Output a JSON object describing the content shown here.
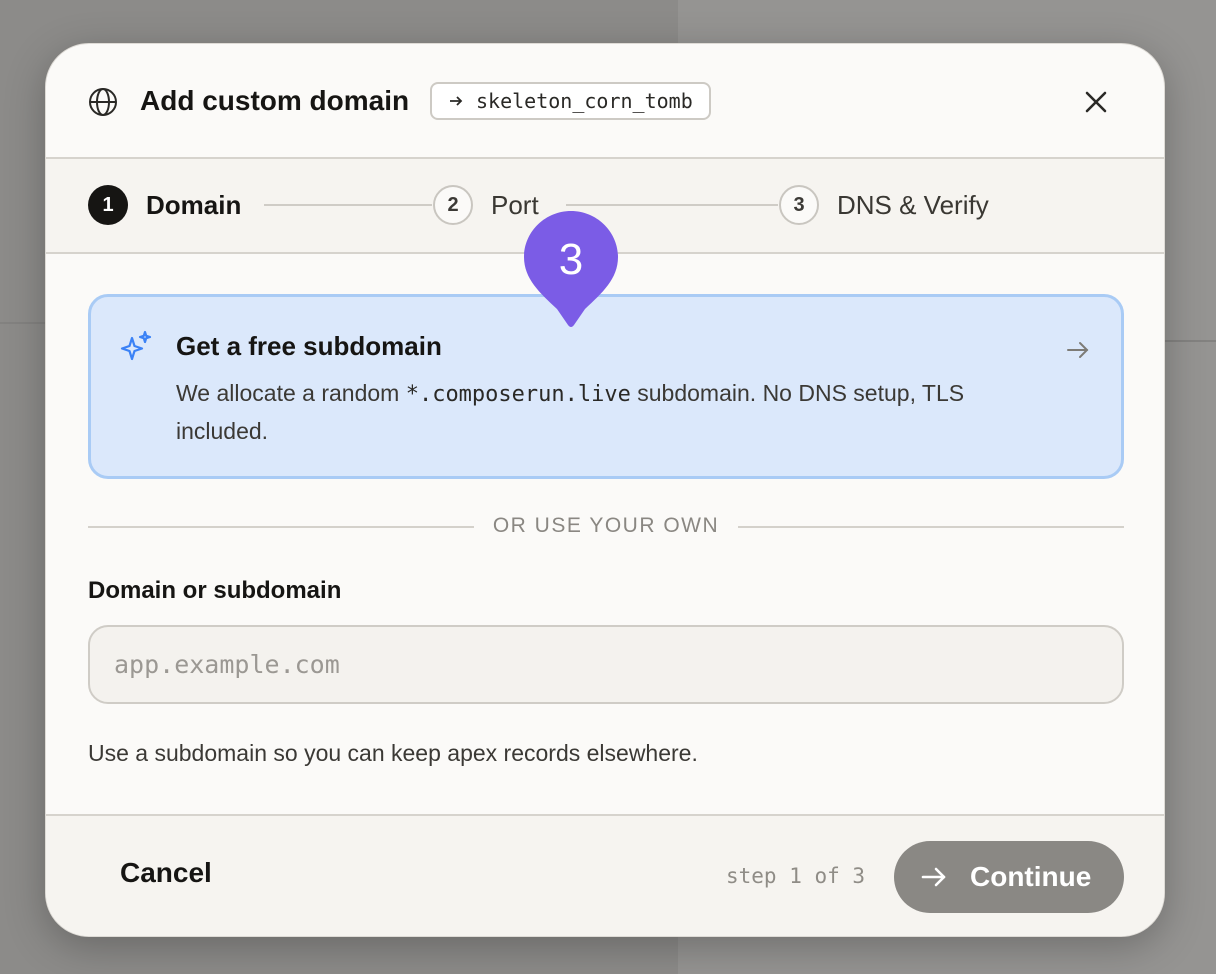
{
  "modal": {
    "title": "Add custom domain",
    "target_tag": "skeleton_corn_tomb",
    "icons": {
      "title": "globe-icon",
      "close": "close-icon",
      "tag": "arrow-right-icon"
    }
  },
  "stepper": {
    "steps": [
      {
        "number": "1",
        "label": "Domain",
        "state": "active"
      },
      {
        "number": "2",
        "label": "Port",
        "state": "idle"
      },
      {
        "number": "3",
        "label": "DNS & Verify",
        "state": "idle"
      }
    ]
  },
  "free_subdomain": {
    "title": "Get a free subdomain",
    "desc_before": "We allocate a random ",
    "desc_code": "*.composerun.live",
    "desc_after": " subdomain. No DNS setup, TLS included.",
    "icon": "sparkle-icon",
    "arrow_icon": "arrow-right-icon"
  },
  "divider": {
    "text": "OR USE YOUR OWN"
  },
  "domain_field": {
    "label": "Domain or subdomain",
    "placeholder": "app.example.com",
    "value": "",
    "help": "Use a subdomain so you can keep apex records elsewhere."
  },
  "footer": {
    "cancel_label": "Cancel",
    "step_counter": "step 1 of 3",
    "continue_label": "Continue",
    "continue_icon": "arrow-right-icon"
  },
  "marker": {
    "number": "3",
    "color": "#7b5ce6"
  },
  "colors": {
    "card_bg": "#dbe8fb",
    "card_border": "#a9cbf5",
    "sparkle": "#3b82f6",
    "continue_bg": "#8a8884"
  }
}
